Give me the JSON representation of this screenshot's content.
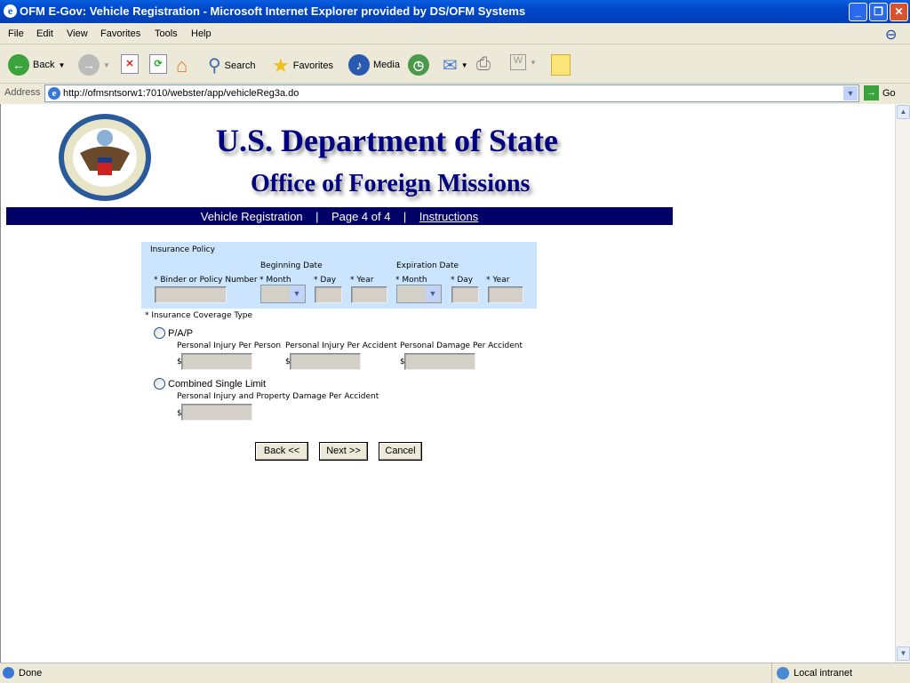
{
  "window": {
    "title": "OFM E-Gov: Vehicle Registration - Microsoft Internet Explorer provided by DS/OFM Systems"
  },
  "menu": [
    "File",
    "Edit",
    "View",
    "Favorites",
    "Tools",
    "Help"
  ],
  "toolbar": {
    "back": "Back",
    "search": "Search",
    "favorites": "Favorites",
    "media": "Media"
  },
  "address": {
    "label": "Address",
    "url": "http://ofmsntsorw1:7010/webster/app/vehicleReg3a.do",
    "go": "Go"
  },
  "header": {
    "seal_text": "DEPARTMENT OF STATE · UNITED STATES OF AMERICA",
    "title": "U.S. Department of State",
    "subtitle": "Office of Foreign Missions"
  },
  "nav": {
    "section": "Vehicle Registration",
    "sep": "|",
    "page": "Page 4 of 4",
    "instructions": "Instructions"
  },
  "policy": {
    "heading": "Insurance Policy",
    "beginning_date": "Beginning Date",
    "expiration_date": "Expiration Date",
    "binder_label": "* Binder or Policy Number",
    "month_label": "* Month",
    "day_label": "* Day",
    "year_label": "* Year",
    "binder_value": "",
    "begin_month": "",
    "begin_day": "",
    "begin_year": "",
    "exp_month": "",
    "exp_day": "",
    "exp_year": ""
  },
  "coverage": {
    "heading": "* Insurance Coverage Type",
    "pap_label": "P/A/P",
    "pap_fields": [
      "Personal Injury Per Person",
      "Personal Injury Per Accident",
      "Personal Damage Per Accident"
    ],
    "csl_label": "Combined Single Limit",
    "csl_field": "Personal Injury and Property Damage Per Accident",
    "currency": "$",
    "selected": null
  },
  "buttons": {
    "back": "Back <<",
    "next": "Next >>",
    "cancel": "Cancel"
  },
  "status": {
    "text": "Done",
    "zone": "Local intranet"
  }
}
